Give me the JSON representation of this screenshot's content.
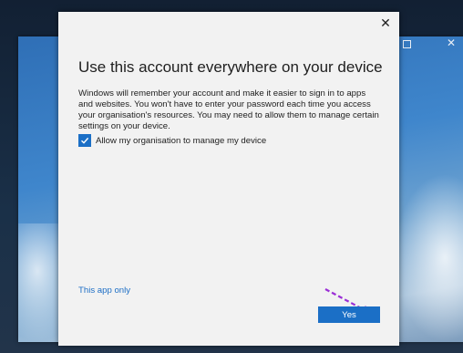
{
  "dialog": {
    "close_glyph": "✕",
    "title": "Use this account everywhere on your device",
    "description": "Windows will remember your account and make it easier to sign in to apps and websites. You won't have to enter your password each time you access your organisation's resources. You may need to allow them to manage certain settings on your device.",
    "checkbox": {
      "label": "Allow my organisation to manage my device",
      "checked": true
    },
    "link_label": "This app only",
    "yes_label": "Yes"
  },
  "background_window": {
    "close_glyph": "✕"
  },
  "colors": {
    "accent": "#1b6fc6",
    "arrow": "#9b2fd6"
  },
  "icons": {
    "checkbox_mark": "checkmark-icon",
    "annotation": "arrow-icon"
  }
}
